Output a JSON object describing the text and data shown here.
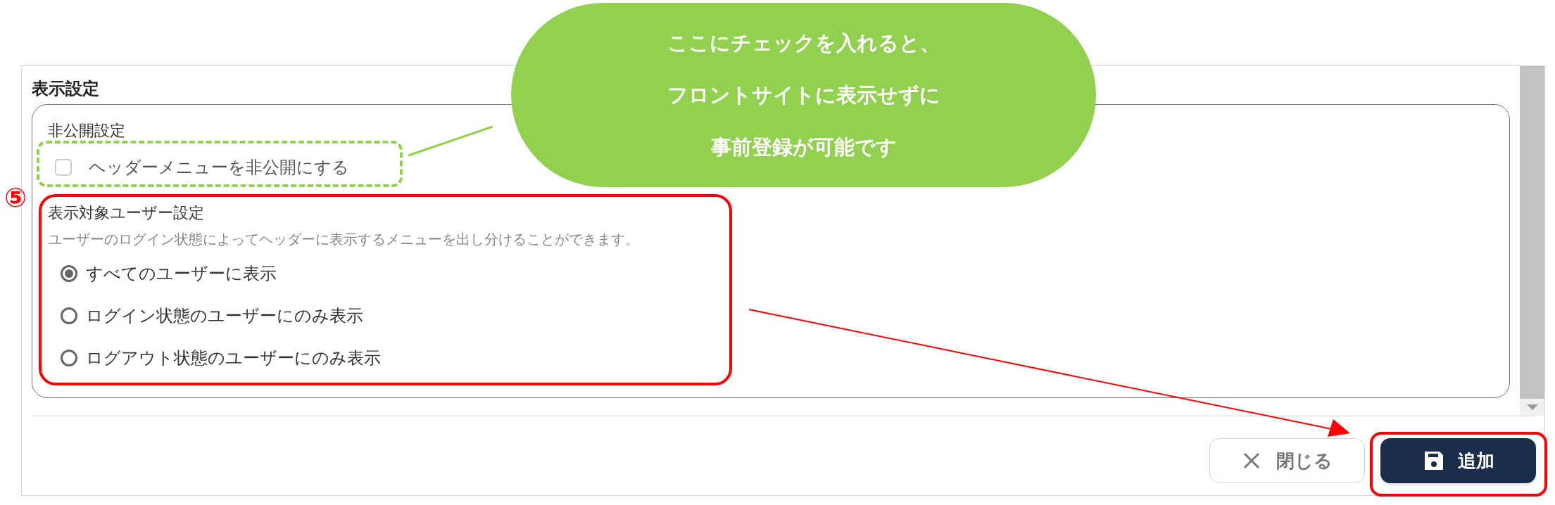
{
  "section_title": "表示設定",
  "private_group": {
    "legend": "非公開設定",
    "checkbox": {
      "label": "ヘッダーメニューを非公開にする",
      "checked": false
    }
  },
  "audience_group": {
    "legend": "表示対象ユーザー設定",
    "description": "ユーザーのログイン状態によってヘッダーに表示するメニューを出し分けることができます。",
    "options": [
      {
        "label": "すべてのユーザーに表示",
        "selected": true
      },
      {
        "label": "ログイン状態のユーザーにのみ表示",
        "selected": false
      },
      {
        "label": "ログアウト状態のユーザーにのみ表示",
        "selected": false
      }
    ]
  },
  "buttons": [
    {
      "label": "閉じる",
      "kind": "close"
    },
    {
      "label": "追加",
      "kind": "save"
    }
  ],
  "annotation": {
    "step_marker": "⑤",
    "callout_lines": [
      "ここにチェックを入れると、",
      "フロントサイトに表示せずに",
      "事前登録が可能です"
    ]
  }
}
